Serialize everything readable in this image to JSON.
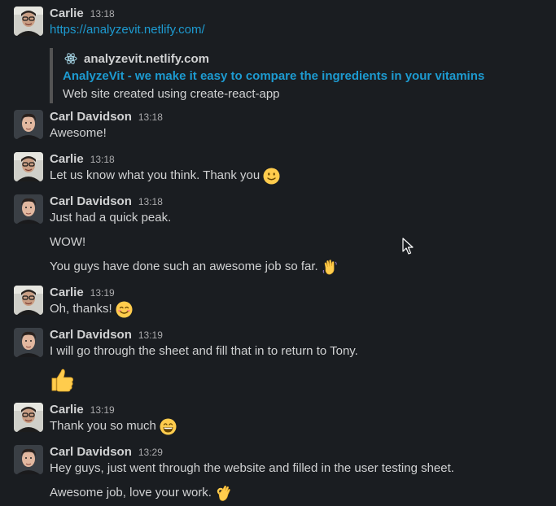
{
  "messages": [
    {
      "sender": "Carlie",
      "time": "13:18",
      "link": "https://analyzevit.netlify.com/",
      "unfurl": {
        "site_icon": "react-atom-icon",
        "site": "analyzevit.netlify.com",
        "title": "AnalyzeVit - we make it easy to compare the ingredients in your vitamins",
        "description": "Web site created using create-react-app"
      }
    },
    {
      "sender": "Carl Davidson",
      "time": "13:18",
      "lines": [
        "Awesome!"
      ]
    },
    {
      "sender": "Carlie",
      "time": "13:18",
      "lines": [
        "Let us know what you think. Thank you"
      ],
      "emoji": "slightly-smiling-face-emoji"
    },
    {
      "sender": "Carl Davidson",
      "time": "13:18",
      "lines": [
        "Just had a quick peak.",
        "WOW!",
        "You guys have done such an awesome job so far."
      ],
      "emoji": "waving-hand-emoji"
    },
    {
      "sender": "Carlie",
      "time": "13:19",
      "lines": [
        "Oh, thanks!"
      ],
      "emoji": "smiling-face-emoji"
    },
    {
      "sender": "Carl Davidson",
      "time": "13:19",
      "lines": [
        "I will go through the sheet and fill that in to return to Tony."
      ],
      "big_emoji": "thumbs-up-emoji"
    },
    {
      "sender": "Carlie",
      "time": "13:19",
      "lines": [
        "Thank you so much"
      ],
      "emoji": "grinning-face-emoji"
    },
    {
      "sender": "Carl Davidson",
      "time": "13:29",
      "lines": [
        "Hey guys, just went through the website and filled in the user testing sheet.",
        "Awesome job, love your work."
      ],
      "emoji": "ok-hand-emoji"
    }
  ],
  "colors": {
    "background": "#1a1d21",
    "text": "#d1d2d3",
    "link": "#1d9bd1",
    "timestamp": "#ababad",
    "unfurl_bar": "#545454"
  }
}
